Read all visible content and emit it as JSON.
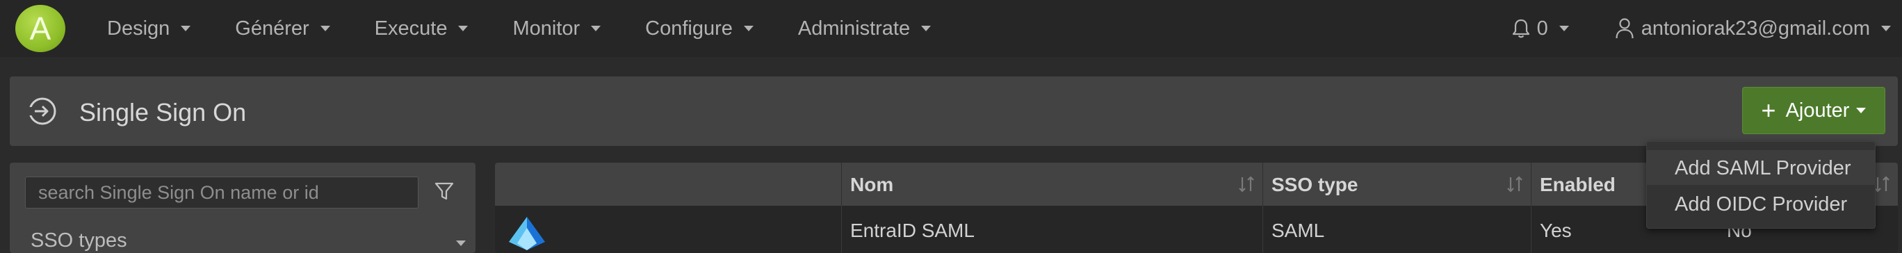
{
  "app": {
    "logo_letter": "A"
  },
  "nav": {
    "items": [
      {
        "label": "Design"
      },
      {
        "label": "Générer"
      },
      {
        "label": "Execute"
      },
      {
        "label": "Monitor"
      },
      {
        "label": "Configure"
      },
      {
        "label": "Administrate"
      }
    ],
    "notifications": {
      "count": "0"
    },
    "user": {
      "email": "antoniorak23@gmail.com"
    }
  },
  "page": {
    "title": "Single Sign On",
    "add_button_label": "Ajouter"
  },
  "filter": {
    "search_placeholder": "search Single Sign On name or id",
    "sso_types_label": "SSO types"
  },
  "table": {
    "columns": [
      {
        "label": ""
      },
      {
        "label": "Nom"
      },
      {
        "label": "SSO type"
      },
      {
        "label": "Enabled"
      }
    ],
    "rows": [
      {
        "icon": "entra-id-icon",
        "name": "EntraID SAML",
        "sso_type": "SAML",
        "enabled": "Yes",
        "extra": "No"
      }
    ]
  },
  "dropdown": {
    "items": [
      {
        "label": "Add SAML Provider"
      },
      {
        "label": "Add OIDC Provider"
      }
    ]
  },
  "colors": {
    "navbar_bg": "#262626",
    "page_bg": "#2b2b2b",
    "panel_bg": "#434343",
    "accent_green": "#4c7a2a",
    "logo_green": "#8fbf2a"
  }
}
